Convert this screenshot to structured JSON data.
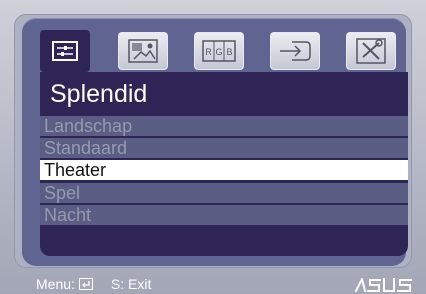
{
  "tabs": [
    {
      "name": "splendid",
      "icon": "splendid-sliders-icon",
      "active": true
    },
    {
      "name": "image",
      "icon": "image-icon",
      "active": false
    },
    {
      "name": "color",
      "icon": "rgb-icon",
      "active": false,
      "icon_text": [
        "R",
        "G",
        "B"
      ]
    },
    {
      "name": "input-select",
      "icon": "input-arrow-icon",
      "active": false
    },
    {
      "name": "system-setup",
      "icon": "tools-icon",
      "active": false
    }
  ],
  "menu": {
    "title": "Splendid",
    "items": [
      {
        "label": "Landschap",
        "selected": false
      },
      {
        "label": "Standaard",
        "selected": false
      },
      {
        "label": "Theater",
        "selected": true
      },
      {
        "label": "Spel",
        "selected": false
      },
      {
        "label": "Nacht",
        "selected": false
      }
    ]
  },
  "footer": {
    "menu_label": "Menu:",
    "menu_icon": "enter-icon",
    "exit_label": "S: Exit"
  },
  "brand": {
    "logo": "ASUS"
  },
  "colors": {
    "panel": "#5f6590",
    "content_bg": "#2e2456",
    "row_bg": "#5b5e84",
    "selected_bg": "#ffffff",
    "text_dim": "#9799ad"
  }
}
